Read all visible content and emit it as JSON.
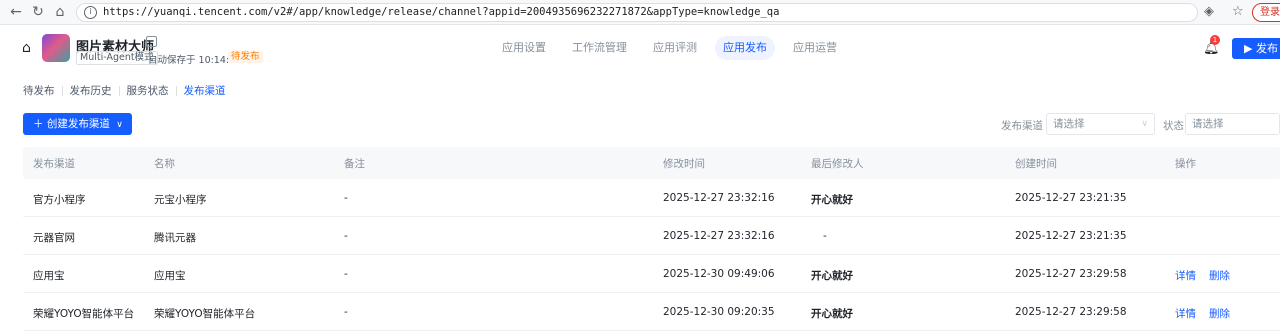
{
  "browser": {
    "url": "https://yuanqi.tencent.com/v2#/app/knowledge/release/channel?appid=2004935696232271872&appType=knowledge_qa",
    "login_label": "登录"
  },
  "app": {
    "name": "图片素材大师",
    "mode": "Multi-Agent模式",
    "autosave": "自动保存于 10:14:21",
    "status_tag": "待发布"
  },
  "top_tabs": [
    "应用设置",
    "工作流管理",
    "应用评测",
    "应用发布",
    "应用运营"
  ],
  "active_top_tab": "应用发布",
  "notification_count": "1",
  "publish_label": "发布",
  "sub_tabs": [
    "待发布",
    "发布历史",
    "服务状态",
    "发布渠道"
  ],
  "create_button": "创建发布渠道",
  "filters": {
    "channel_label": "发布渠道",
    "channel_placeholder": "请选择",
    "status_label": "状态",
    "status_placeholder": "请选择"
  },
  "table": {
    "columns": [
      "发布渠道",
      "名称",
      "备注",
      "修改时间",
      "最后修改人",
      "创建时间",
      "操作"
    ],
    "rows": [
      {
        "channel": "官方小程序",
        "name": "元宝小程序",
        "note": "-",
        "modified": "2025-12-27 23:32:16",
        "modifier": "开心就好",
        "created": "2025-12-27 23:21:35",
        "actions": []
      },
      {
        "channel": "元器官网",
        "name": "腾讯元器",
        "note": "-",
        "modified": "2025-12-27 23:32:16",
        "modifier": "-",
        "created": "2025-12-27 23:21:35",
        "actions": []
      },
      {
        "channel": "应用宝",
        "name": "应用宝",
        "note": "-",
        "modified": "2025-12-30 09:49:06",
        "modifier": "开心就好",
        "created": "2025-12-27 23:29:58",
        "actions": [
          "详情",
          "删除"
        ]
      },
      {
        "channel": "荣耀YOYO智能体平台",
        "name": "荣耀YOYO智能体平台",
        "note": "-",
        "modified": "2025-12-30 09:20:35",
        "modifier": "开心就好",
        "created": "2025-12-27 23:29:58",
        "actions": [
          "详情",
          "删除"
        ]
      }
    ]
  },
  "colors": {
    "accent": "#165dff",
    "warning": "#ff7d00",
    "badge": "#f53f3f"
  }
}
